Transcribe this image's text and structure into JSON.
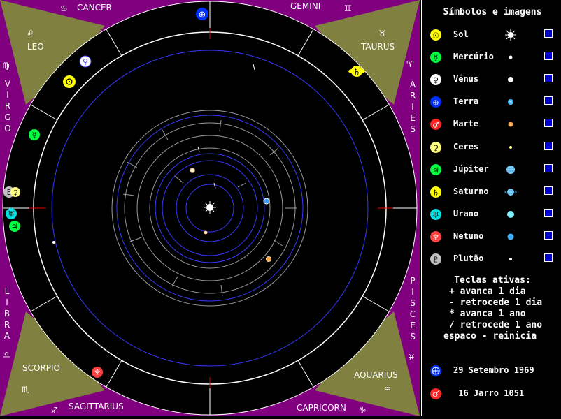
{
  "zodiac": {
    "cancer": "CANCER",
    "gemini": "GEMINI",
    "leo": "LEO",
    "taurus": "TAURUS",
    "virgo": "VIRGO",
    "aries": "ARIES",
    "libra": "LIBRA",
    "pisces": "PISCES",
    "scorpio": "SCORPIO",
    "aquarius": "AQUARIUS",
    "sagittarius": "SAGITTARIUS",
    "capricorn": "CAPRICORN",
    "glyphs": {
      "cancer": "♋",
      "gemini": "♊",
      "leo": "♌",
      "taurus": "♉",
      "virgo": "♍",
      "aries": "♈",
      "libra": "♎",
      "pisces": "♓",
      "scorpio": "♏",
      "aquarius": "♒",
      "sagittarius": "♐",
      "capricorn": "♑"
    }
  },
  "panel": {
    "title": "Símbolos e imagens",
    "planets": [
      {
        "name": "Sol",
        "color": "#ffff00",
        "symbol": "☉",
        "image": "sun-image-icon"
      },
      {
        "name": "Mercúrio",
        "color": "#00ff40",
        "symbol": "☿",
        "image": "mercury-image-icon"
      },
      {
        "name": "Vênus",
        "color": "#ffffff",
        "symbol": "♀",
        "image": "venus-image-icon"
      },
      {
        "name": "Terra",
        "color": "#0030ff",
        "symbol": "⊕",
        "image": "earth-image-icon"
      },
      {
        "name": "Marte",
        "color": "#ff2020",
        "symbol": "♂",
        "image": "mars-image-icon"
      },
      {
        "name": "Ceres",
        "color": "#ffff80",
        "symbol": "⚳",
        "image": "ceres-image-icon"
      },
      {
        "name": "Júpiter",
        "color": "#00ff40",
        "symbol": "♃",
        "image": "jupiter-image-icon"
      },
      {
        "name": "Saturno",
        "color": "#ffff00",
        "symbol": "♄",
        "image": "saturn-image-icon"
      },
      {
        "name": "Urano",
        "color": "#00e0e0",
        "symbol": "♅",
        "image": "uranus-image-icon"
      },
      {
        "name": "Netuno",
        "color": "#ff4040",
        "symbol": "♆",
        "image": "neptune-image-icon"
      },
      {
        "name": "Plutão",
        "color": "#c0c0c0",
        "symbol": "♇",
        "image": "pluto-image-icon"
      }
    ],
    "keys": {
      "title": "Teclas ativas:",
      "items": [
        "+ avanca 1 dia",
        "- retrocede 1 dia",
        "* avanca 1 ano",
        "/ retrocede 1 ano",
        "espaco - reinicia"
      ]
    },
    "dates": [
      {
        "label": "29 Setembro 1969",
        "color": "#0030ff",
        "symbol": "⊕"
      },
      {
        "label": " 16 Jarro 1051",
        "color": "#ff2020",
        "symbol": "♂"
      }
    ]
  },
  "colors": {
    "purple": "#800080",
    "olive": "#808040",
    "orbit_blue": "#3838ff",
    "orbit_gray": "#9a9a9a",
    "tick_red": "#e00000",
    "checkbox": "#0000c8"
  }
}
